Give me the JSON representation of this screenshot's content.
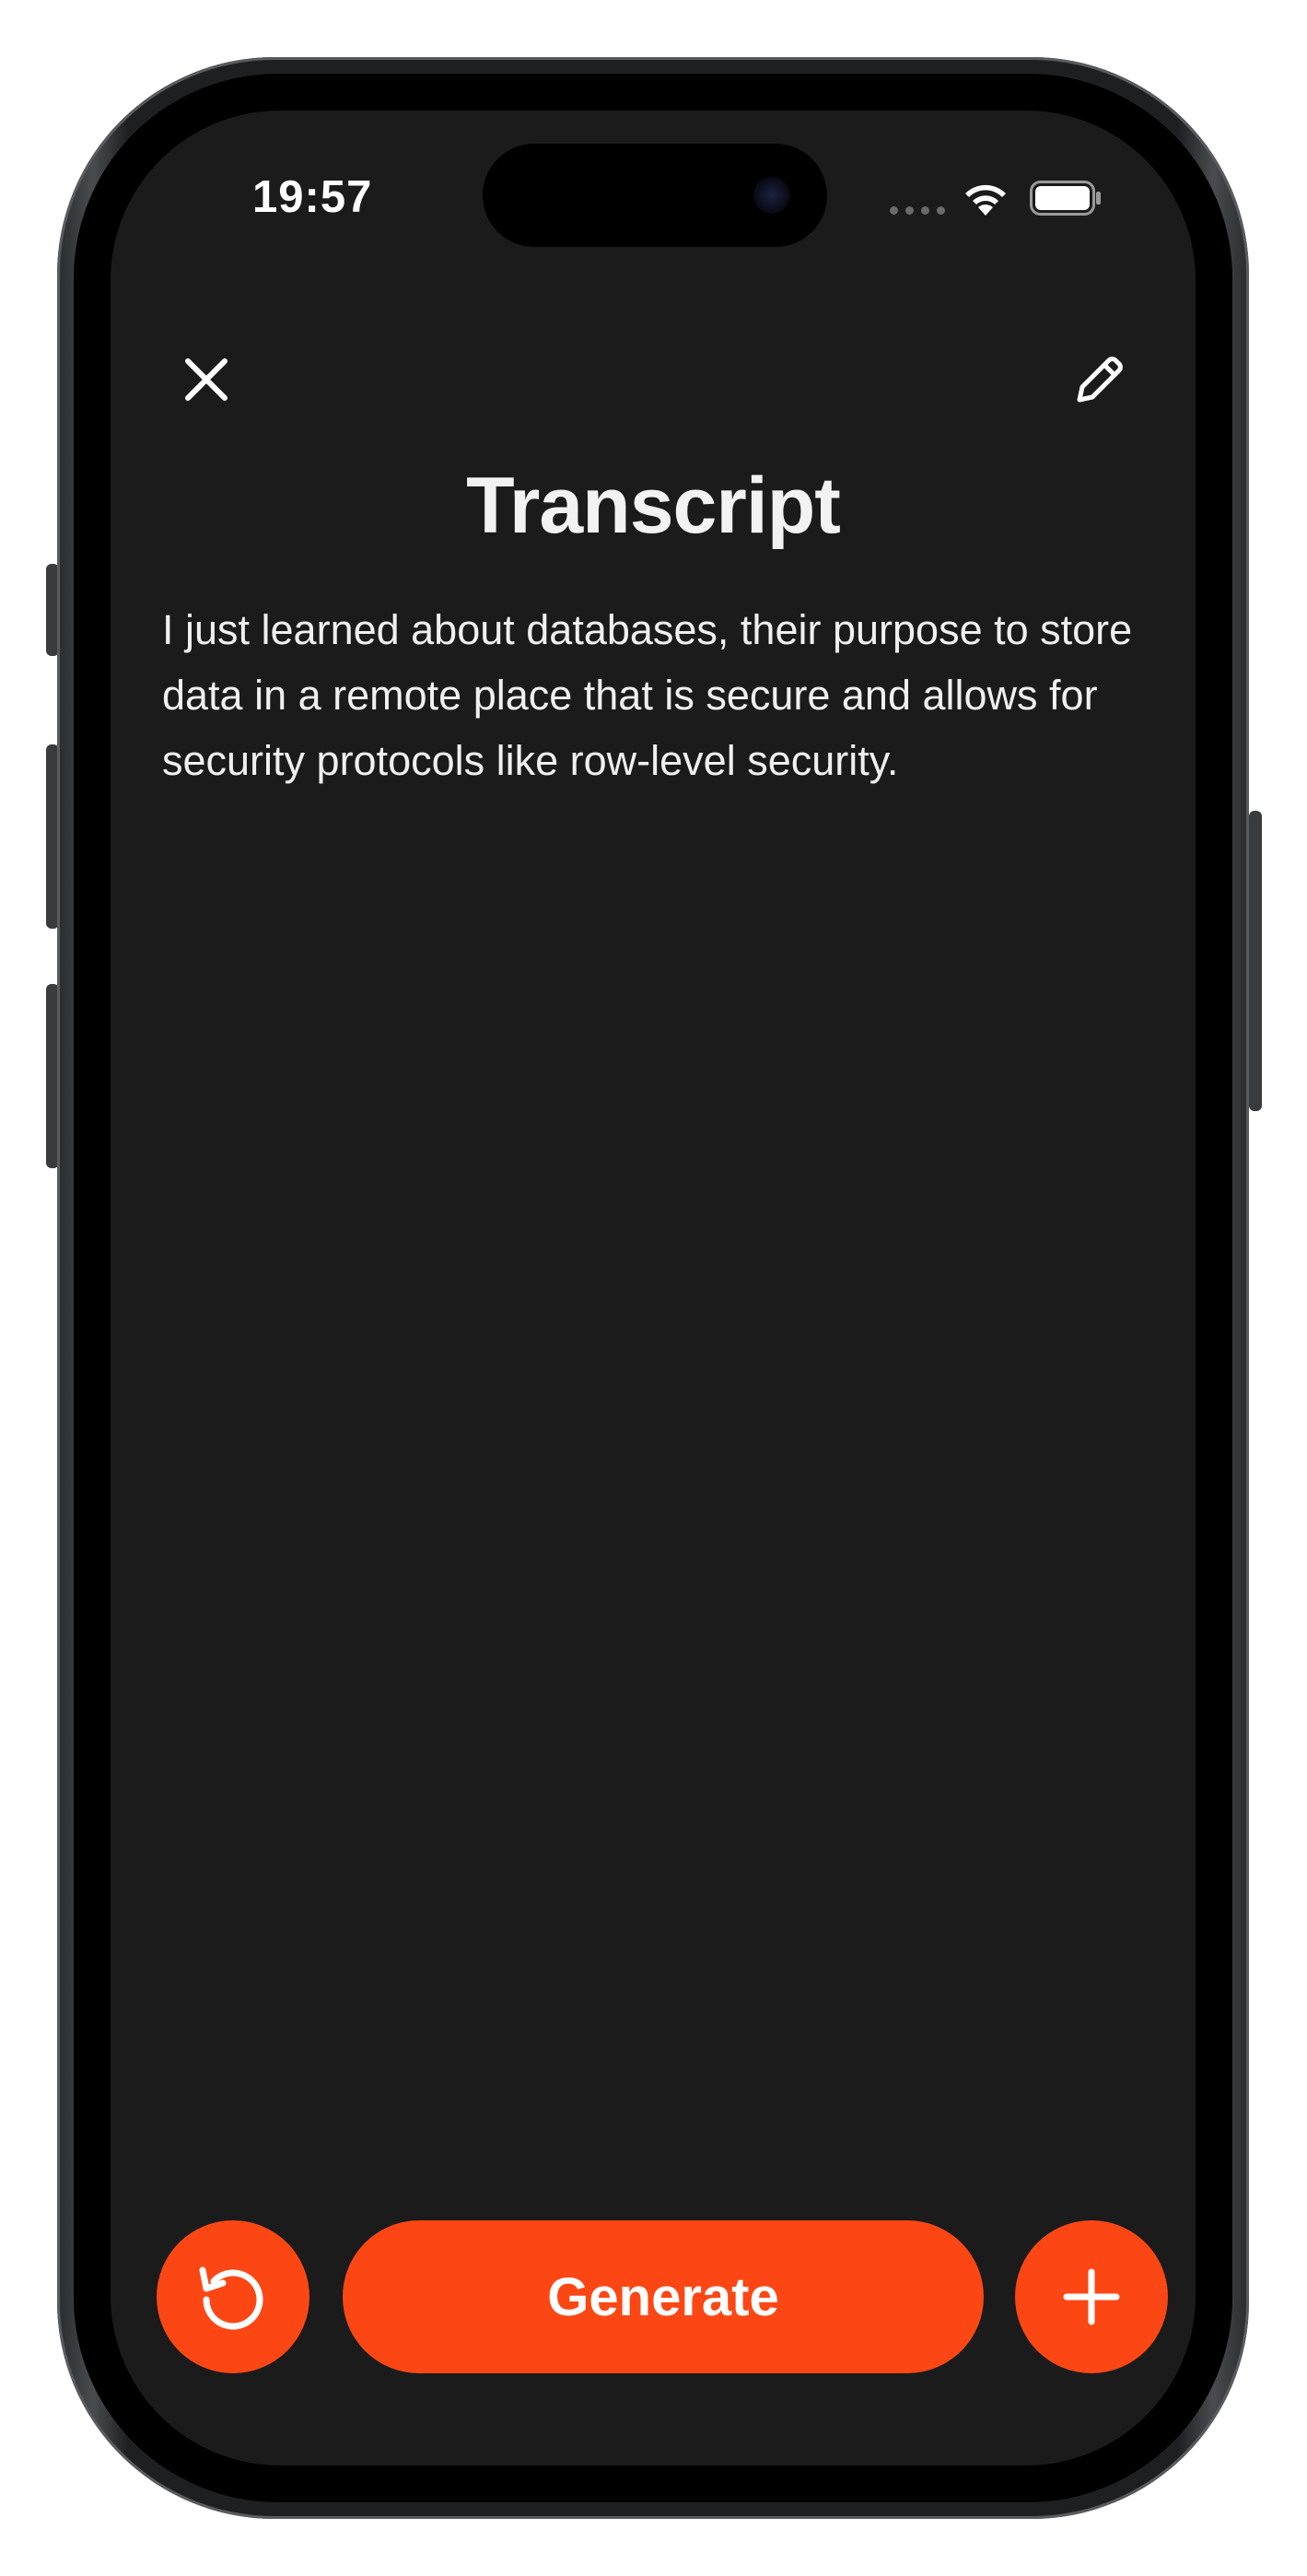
{
  "status_bar": {
    "time": "19:57",
    "wifi_icon": "wifi-icon",
    "battery_icon": "battery-icon"
  },
  "header": {
    "close_icon": "close-icon",
    "edit_icon": "pencil-icon",
    "title": "Transcript"
  },
  "transcript": {
    "text": "I just learned about databases, their purpose to store data in a remote place that is secure and allows for security protocols like row-level security."
  },
  "actions": {
    "reset_icon": "rotate-ccw-icon",
    "generate_label": "Generate",
    "add_icon": "plus-icon"
  },
  "colors": {
    "accent": "#fc4714",
    "screen_background": "#1b1b1b",
    "text": "#f0f0f0"
  }
}
